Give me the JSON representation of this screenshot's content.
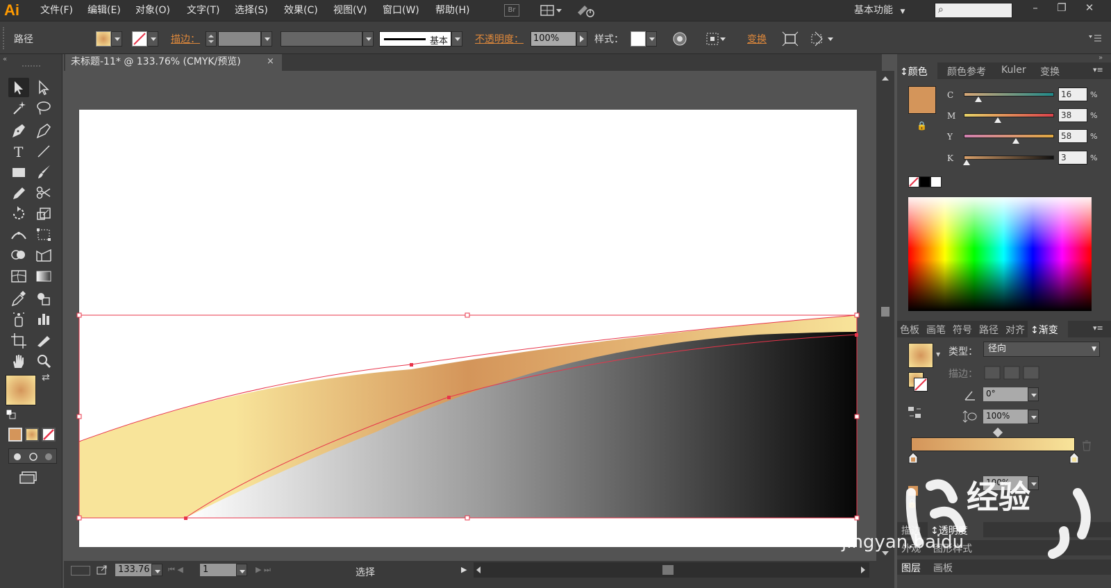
{
  "app": {
    "logo": "Ai",
    "menu": [
      "文件(F)",
      "编辑(E)",
      "对象(O)",
      "文字(T)",
      "选择(S)",
      "效果(C)",
      "视图(V)",
      "窗口(W)",
      "帮助(H)"
    ],
    "bridge_label": "Br",
    "workspace": "基本功能",
    "window_buttons": [
      "–",
      "❐",
      "✕"
    ]
  },
  "control_bar": {
    "object_type": "路径",
    "stroke_label": "描边：",
    "stroke_style": "基本",
    "opacity_label": "不透明度：",
    "opacity_value": "100%",
    "style_label": "样式：",
    "transform_label": "变换"
  },
  "document": {
    "tab_title": "未标题-11* @ 133.76% (CMYK/预览)",
    "close": "×"
  },
  "status_bar": {
    "zoom": "133.76",
    "page": "1",
    "tool": "选择"
  },
  "color_panel": {
    "tabs": [
      "颜色",
      "颜色参考",
      "Kuler",
      "变换"
    ],
    "channels": [
      {
        "name": "C",
        "value": "16",
        "level": 0.16
      },
      {
        "name": "M",
        "value": "38",
        "level": 0.38
      },
      {
        "name": "Y",
        "value": "58",
        "level": 0.58
      },
      {
        "name": "K",
        "value": "3",
        "level": 0.03
      }
    ],
    "percent": "%",
    "swatch_color": "#d4955a"
  },
  "gradient_panel": {
    "tabs": [
      "色板",
      "画笔",
      "符号",
      "路径",
      "对齐",
      "渐变"
    ],
    "type_label": "类型：",
    "type_value": "径向",
    "stroke_label": "描边：",
    "angle": "0°",
    "aspect": "100%",
    "stop_opacity": "100%",
    "stop_colors": [
      "#d4955a",
      "#f8e49a"
    ]
  },
  "lower_panel": {
    "tabs1": [
      "描边",
      "透明度"
    ],
    "tabs2": [
      "外观",
      "图形样式"
    ],
    "tabs3": [
      "图层",
      "画板"
    ]
  },
  "watermark": {
    "text": "jingyan.baidu",
    "logo": "经验"
  },
  "colors": {
    "accent": "#e0893b",
    "selection": "#e8344a",
    "gold_light": "#f8e49a",
    "gold_dark": "#d4955a"
  }
}
